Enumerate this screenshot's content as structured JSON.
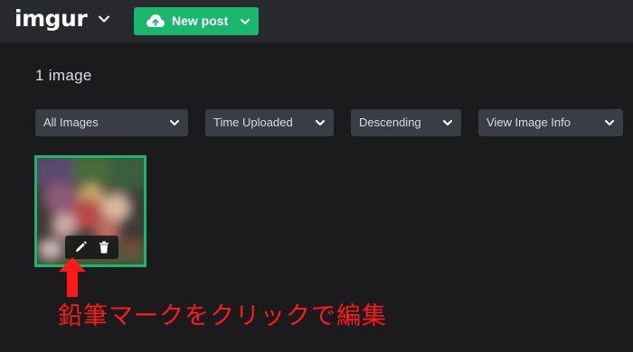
{
  "header": {
    "logo_text": "imgur",
    "new_post_label": "New post",
    "brand_color": "#1bb76e",
    "icons": {
      "logo_menu": "chevron-down-icon",
      "upload": "cloud-upload-icon",
      "new_post_menu": "chevron-down-icon"
    }
  },
  "main": {
    "image_count": "1 image",
    "filters": [
      {
        "label": "All Images"
      },
      {
        "label": "Time Uploaded"
      },
      {
        "label": "Descending"
      },
      {
        "label": "View Image Info"
      }
    ],
    "thumbnail": {
      "selected_border_color": "#1bb76e",
      "tools": [
        "pencil-icon",
        "trash-icon"
      ]
    }
  },
  "annotation": {
    "text": "鉛筆マークをクリックで編集",
    "color": "#ff1a1a"
  }
}
